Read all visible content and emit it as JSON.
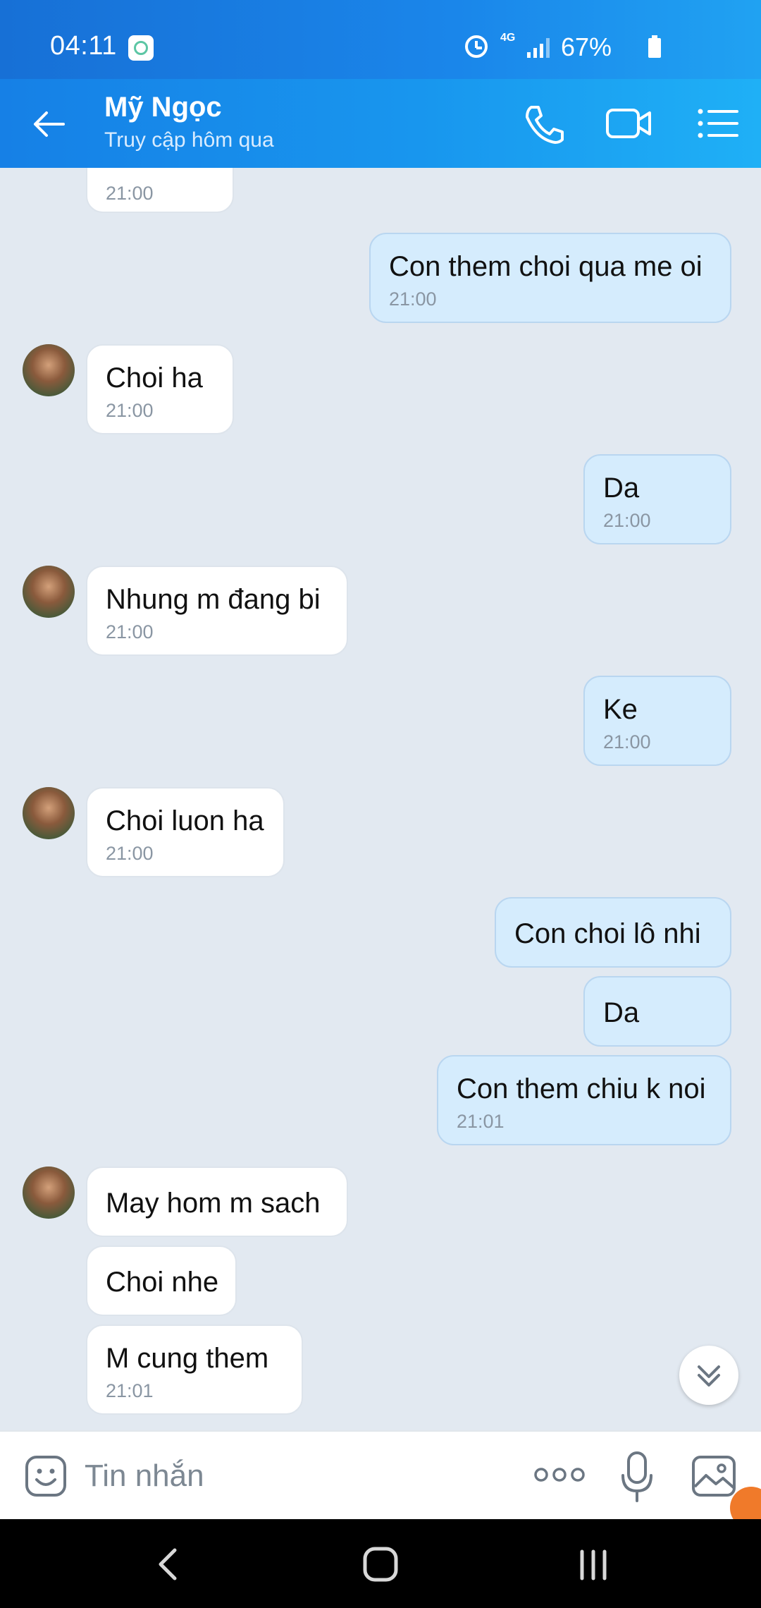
{
  "status_bar": {
    "time": "04:11",
    "network": "4G",
    "battery": "67%",
    "icons": [
      "health-app-icon",
      "alarm-icon",
      "4g-icon",
      "signal-icon",
      "battery-icon"
    ]
  },
  "header": {
    "contact_name": "Mỹ Ngọc",
    "status": "Truy cập hôm qua",
    "icons": [
      "back-arrow-icon",
      "phone-icon",
      "video-camera-icon",
      "menu-list-icon"
    ]
  },
  "messages": [
    {
      "side": "in",
      "text": "",
      "time": "21:00"
    },
    {
      "side": "out",
      "text": "Con them choi qua me oi",
      "time": "21:00"
    },
    {
      "side": "in",
      "text": "Choi ha",
      "time": "21:00"
    },
    {
      "side": "out",
      "text": "Da",
      "time": "21:00"
    },
    {
      "side": "in",
      "text": "Nhung m đang bi",
      "time": "21:00"
    },
    {
      "side": "out",
      "text": "Ke",
      "time": "21:00"
    },
    {
      "side": "in",
      "text": "Choi luon ha",
      "time": "21:00"
    },
    {
      "side": "out",
      "text": "Con choi lô nhi",
      "time": ""
    },
    {
      "side": "out",
      "text": "Da",
      "time": ""
    },
    {
      "side": "out",
      "text": "Con them chiu k noi",
      "time": "21:01"
    },
    {
      "side": "in",
      "text": "May hom m sach",
      "time": ""
    },
    {
      "side": "in",
      "text": "Choi nhe",
      "time": ""
    },
    {
      "side": "in",
      "text": "M cung them",
      "time": "21:01"
    }
  ],
  "input_bar": {
    "placeholder": "Tin nhắn",
    "icons": [
      "emoji-icon",
      "more-options-icon",
      "microphone-icon",
      "image-icon"
    ]
  },
  "colors": {
    "header": "#1896ee",
    "incoming_bubble": "#ffffff",
    "outgoing_bubble": "#d5ecfd",
    "chat_background": "#e2e9f1"
  }
}
